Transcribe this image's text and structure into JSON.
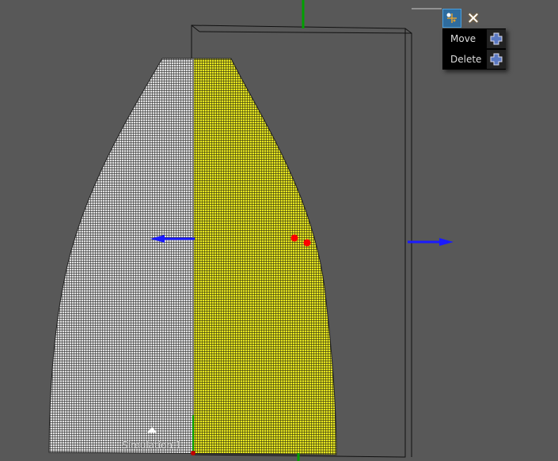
{
  "context_menu": {
    "items": [
      {
        "label": "Move",
        "icon": "move-cross-icon"
      },
      {
        "label": "Delete",
        "icon": "delete-cross-icon"
      }
    ]
  },
  "toolbar": {
    "settings_icon": "gizmo-settings-icon",
    "close_icon": "close-icon",
    "close_glyph": "✕"
  },
  "scene": {
    "object_label": "Simulation 1",
    "colors": {
      "background": "#585858",
      "mesh_left": "#c8c8c8",
      "mesh_right": "#d8d820",
      "arrow": "#1a1aff",
      "axis_green": "#00a000",
      "marker_red": "#ff0000"
    }
  }
}
